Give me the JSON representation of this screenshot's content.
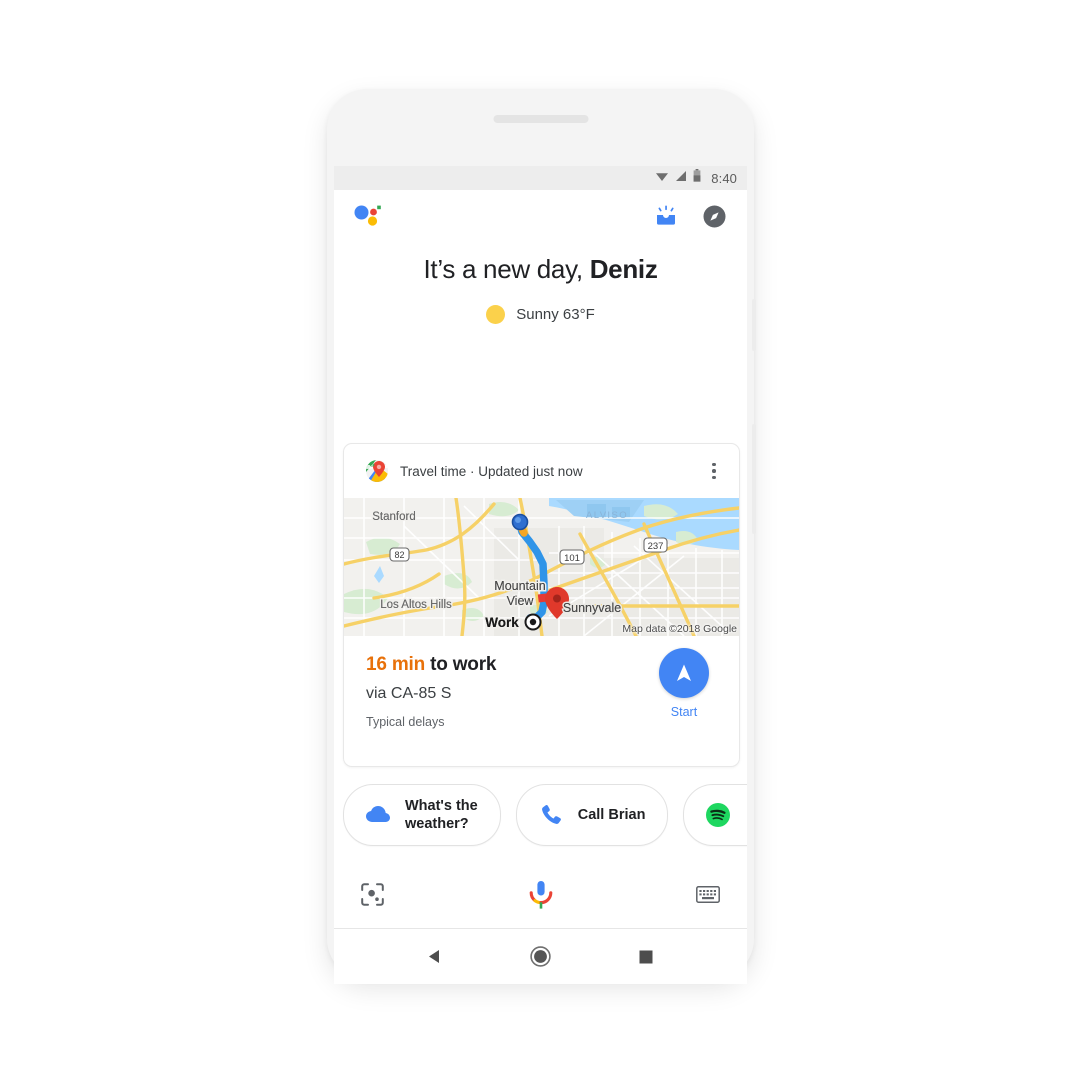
{
  "status_bar": {
    "time": "8:40",
    "icons": [
      "wifi-icon",
      "signal-icon",
      "battery-icon"
    ]
  },
  "assistant_header": {
    "logo": "google-assistant-logo",
    "snapshot_icon": "snapshot-inbox-icon",
    "explore_icon": "explore-compass-icon"
  },
  "greeting": {
    "prefix": "It’s a new day, ",
    "name": "Deniz"
  },
  "weather": {
    "icon": "sunny-icon",
    "text": "Sunny 63°F",
    "sun_color": "#fbd14b"
  },
  "travel_card": {
    "app_icon": "google-maps-icon",
    "header_title": "Travel time · Updated just now",
    "overflow_icon": "more-vertical-icon",
    "map": {
      "attribution": "Map data ©2018 Google",
      "labels": [
        "Stanford",
        "Los Altos Hills",
        "Mountain View",
        "Work",
        "Sunnyvale",
        "ALVISO"
      ],
      "highway_shields": [
        "82",
        "101",
        "237"
      ],
      "route_color": "#2f94e8",
      "origin_marker": "origin-dot",
      "destination_marker": "destination-pin"
    },
    "eta": {
      "time": "16 min",
      "to": " to ",
      "destination": "work",
      "time_color": "#e8710a"
    },
    "via": "via CA-85 S",
    "delays": "Typical delays",
    "start": {
      "label": "Start",
      "icon": "navigation-arrow-icon",
      "color": "#4285f4"
    }
  },
  "chips": [
    {
      "icon": "cloud-weather-icon",
      "label": "What's the\nweather?",
      "line1": "What's the",
      "line2": "weather?"
    },
    {
      "icon": "phone-call-icon",
      "label": "Call Brian"
    },
    {
      "icon": "spotify-icon",
      "label": ""
    }
  ],
  "input_bar": {
    "lens_icon": "google-lens-icon",
    "mic_icon": "google-mic-icon",
    "keyboard_icon": "keyboard-icon"
  },
  "nav_bar": {
    "back_icon": "back-triangle-icon",
    "home_icon": "home-circle-icon",
    "recents_icon": "recents-square-icon"
  },
  "device": {
    "speaker": "earpiece-speaker",
    "power_button": "power-button",
    "volume_button": "volume-button"
  }
}
